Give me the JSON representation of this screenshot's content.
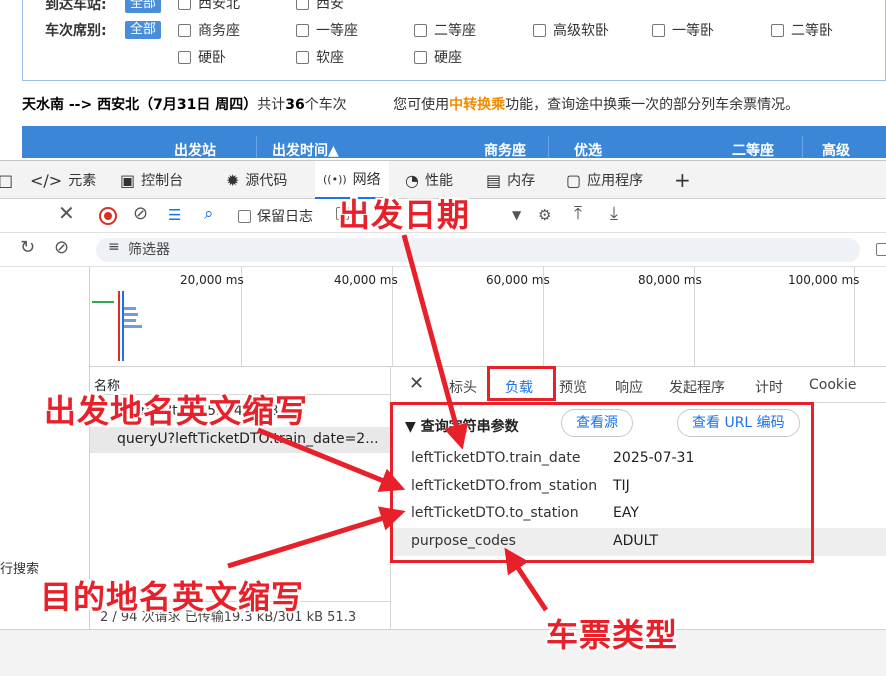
{
  "page": {
    "filters": {
      "arrival_label": "到达车站:",
      "all_tag": "全部",
      "arrival_options": [
        "西安北",
        "西安"
      ],
      "seat_label": "车次席别:",
      "seat_all_tag": "全部",
      "seat_options": [
        "商务座",
        "一等座",
        "二等座",
        "高级软卧",
        "一等卧",
        "二等卧",
        "硬卧",
        "软座",
        "硬座"
      ]
    },
    "summary": {
      "route": "天水南 --> 西安北（7月31日 周四）",
      "count_prefix": "共计",
      "count": "36",
      "count_suffix": "个车次",
      "note_prefix": "您可使用",
      "note_link": "中转换乘",
      "note_suffix": "功能，查询途中换乘一次的部分列车余票情况。"
    },
    "table_headers": [
      "出发站",
      "出发时间▲",
      "商务座",
      "优选",
      "二等座",
      "高级"
    ]
  },
  "devtools": {
    "tabs": [
      {
        "icon": "</>",
        "label": "元素"
      },
      {
        "icon": "▣",
        "label": "控制台"
      },
      {
        "icon": "✹",
        "label": "源代码"
      },
      {
        "icon": "((•))",
        "label": "网络"
      },
      {
        "icon": "◔",
        "label": "性能"
      },
      {
        "icon": "▤",
        "label": "内存"
      },
      {
        "icon": "▢",
        "label": "应用程序"
      },
      {
        "icon": "+",
        "label": ""
      }
    ],
    "toolbar": {
      "preserve_log": "保留日志"
    },
    "filter_placeholder": "筛选器",
    "timeline_ticks": [
      "20,000 ms",
      "40,000 ms",
      "60,000 ms",
      "80,000 ms",
      "100,000 ms"
    ],
    "left_search": "行搜索",
    "list": {
      "name_header": "名称",
      "rows": [
        "queryU?t=1753942208...",
        "queryU?leftTicketDTO.train_date=2..."
      ]
    },
    "status_bar": "2 / 94 次请求   已传输19.3 kB/301 kB   51.3",
    "detail_tabs": [
      "标头",
      "负载",
      "预览",
      "响应",
      "发起程序",
      "计时",
      "Cookie"
    ],
    "payload": {
      "section_title": "▼ 查询字符串参数",
      "view_source": "查看源",
      "view_url_encoded": "查看 URL 编码",
      "params": [
        {
          "key": "leftTicketDTO.train_date",
          "value": "2025-07-31"
        },
        {
          "key": "leftTicketDTO.from_station",
          "value": "TIJ"
        },
        {
          "key": "leftTicketDTO.to_station",
          "value": "EAY"
        },
        {
          "key": "purpose_codes",
          "value": "ADULT"
        }
      ]
    }
  },
  "annotations": {
    "departure_date": "出发日期",
    "departure_abbr": "出发地名英文缩写",
    "destination_abbr": "目的地名英文缩写",
    "ticket_type": "车票类型",
    "color": "#e8202a"
  }
}
